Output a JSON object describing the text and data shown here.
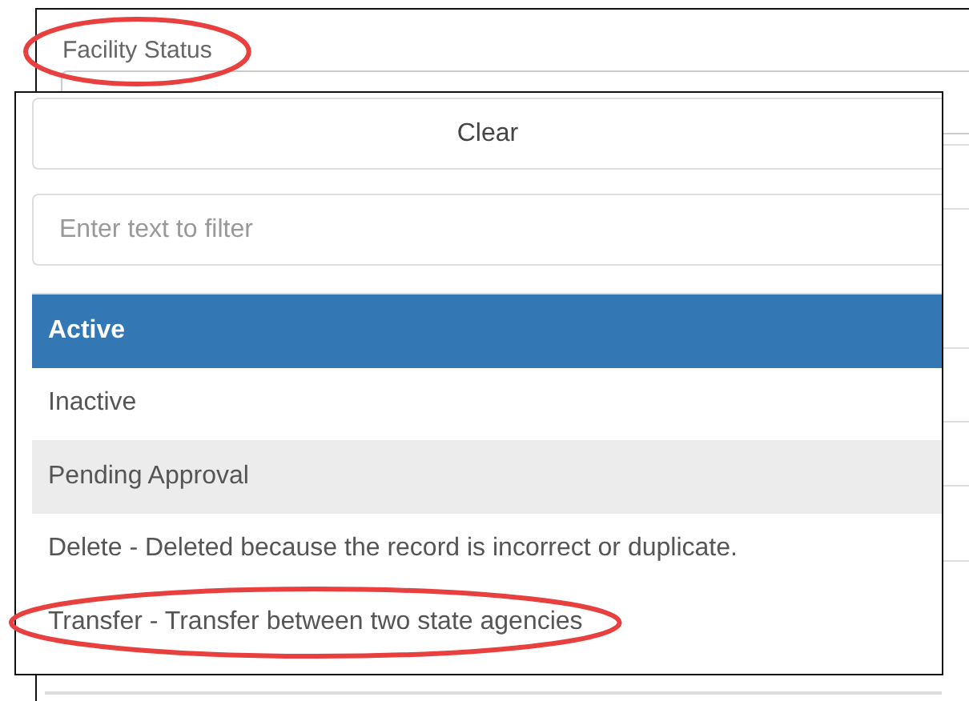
{
  "field": {
    "label": "Facility Status",
    "circled": true
  },
  "dropdown": {
    "clear_button": "Clear",
    "filter": {
      "placeholder": "Enter text to filter"
    },
    "options": [
      {
        "label": "Active",
        "selected": true,
        "hovered": false,
        "circled": false
      },
      {
        "label": "Inactive",
        "selected": false,
        "hovered": false,
        "circled": false
      },
      {
        "label": "Pending Approval",
        "selected": false,
        "hovered": true,
        "circled": false
      },
      {
        "label": "Delete - Deleted because the record is incorrect or duplicate.",
        "selected": false,
        "hovered": false,
        "circled": false
      },
      {
        "label": "Transfer - Transfer between two state agencies",
        "selected": false,
        "hovered": false,
        "circled": true
      }
    ]
  }
}
